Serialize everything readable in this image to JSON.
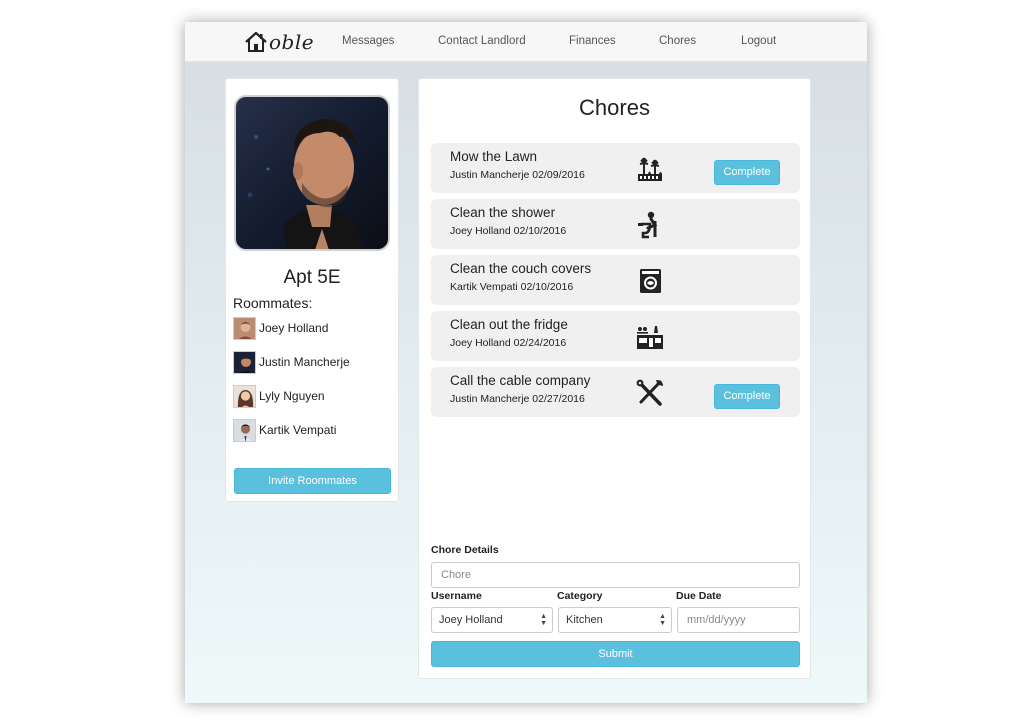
{
  "nav": {
    "logo_text": "oble",
    "links": [
      "Messages",
      "Contact Landlord",
      "Finances",
      "Chores",
      "Logout"
    ]
  },
  "profile": {
    "apt": "Apt 5E",
    "roommates_heading": "Roommates:",
    "roommates": [
      {
        "name": "Joey Holland"
      },
      {
        "name": "Justin Mancherje"
      },
      {
        "name": "Lyly Nguyen"
      },
      {
        "name": "Kartik Vempati"
      }
    ],
    "invite_label": "Invite Roommates"
  },
  "chores": {
    "title": "Chores",
    "items": [
      {
        "title": "Mow the Lawn",
        "subtitle": "Justin Mancherje 02/09/2016",
        "icon": "lawn-icon",
        "action": "Complete"
      },
      {
        "title": "Clean the shower",
        "subtitle": "Joey Holland 02/10/2016",
        "icon": "toilet-cleaning-icon",
        "action": null
      },
      {
        "title": "Clean the couch covers",
        "subtitle": "Kartik Vempati 02/10/2016",
        "icon": "washing-machine-icon",
        "action": null
      },
      {
        "title": "Clean out the fridge",
        "subtitle": "Joey Holland 02/24/2016",
        "icon": "kitchen-icon",
        "action": null
      },
      {
        "title": "Call the cable company",
        "subtitle": "Justin Mancherje 02/27/2016",
        "icon": "tools-icon",
        "action": "Complete"
      }
    ]
  },
  "form": {
    "details_label": "Chore Details",
    "chore_placeholder": "Chore",
    "username_label": "Username",
    "username_value": "Joey Holland",
    "category_label": "Category",
    "category_value": "Kitchen",
    "due_label": "Due Date",
    "due_placeholder": "mm/dd/yyyy",
    "submit_label": "Submit"
  },
  "colors": {
    "accent": "#5bc0de",
    "accent_border": "#46b8da",
    "card_bg": "#f0f0f0"
  }
}
